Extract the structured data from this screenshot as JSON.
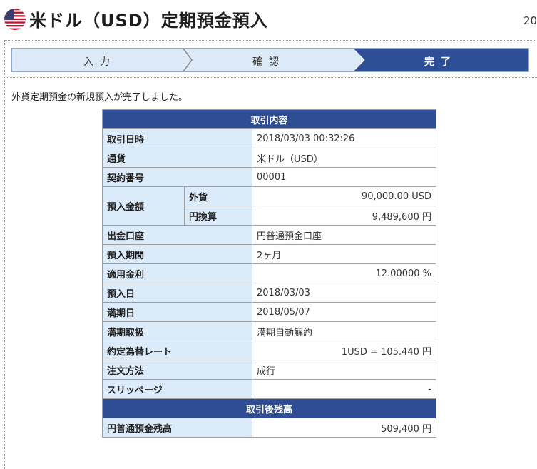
{
  "header": {
    "title": "米ドル（USD）定期預金預入",
    "right_text": "20"
  },
  "steps": [
    {
      "label": "入力"
    },
    {
      "label": "確認"
    },
    {
      "label": "完了"
    }
  ],
  "message": "外貨定期預金の新規預入が完了しました。",
  "sections": {
    "trade_details": "取引内容",
    "after_balance": "取引後残高"
  },
  "details": {
    "trade_datetime": {
      "label": "取引日時",
      "value": "2018/03/03 00:32:26"
    },
    "currency": {
      "label": "通貨",
      "value": "米ドル（USD）"
    },
    "contract_no": {
      "label": "契約番号",
      "value": "00001"
    },
    "deposit_amount": {
      "label": "預入金額",
      "foreign": {
        "label": "外貨",
        "value": "90,000.00 USD"
      },
      "yen": {
        "label": "円換算",
        "value": "9,489,600 円"
      }
    },
    "withdraw_account": {
      "label": "出金口座",
      "value": "円普通預金口座"
    },
    "period": {
      "label": "預入期間",
      "value": "2ヶ月"
    },
    "rate": {
      "label": "適用金利",
      "value": "12.00000 %"
    },
    "deposit_date": {
      "label": "預入日",
      "value": "2018/03/03"
    },
    "maturity_date": {
      "label": "満期日",
      "value": "2018/05/07"
    },
    "maturity_handling": {
      "label": "満期取扱",
      "value": "満期自動解約"
    },
    "exchange_rate": {
      "label": "約定為替レート",
      "value": "1USD = 105.440 円"
    },
    "order_method": {
      "label": "注文方法",
      "value": "成行"
    },
    "slippage": {
      "label": "スリッページ",
      "value": "-"
    }
  },
  "balance": {
    "label": "円普通預金残高",
    "value": "509,400 円"
  },
  "colors": {
    "header_blue": "#2f4d92",
    "label_bg": "#dcebfa",
    "step_bg": "#dceaf8"
  }
}
